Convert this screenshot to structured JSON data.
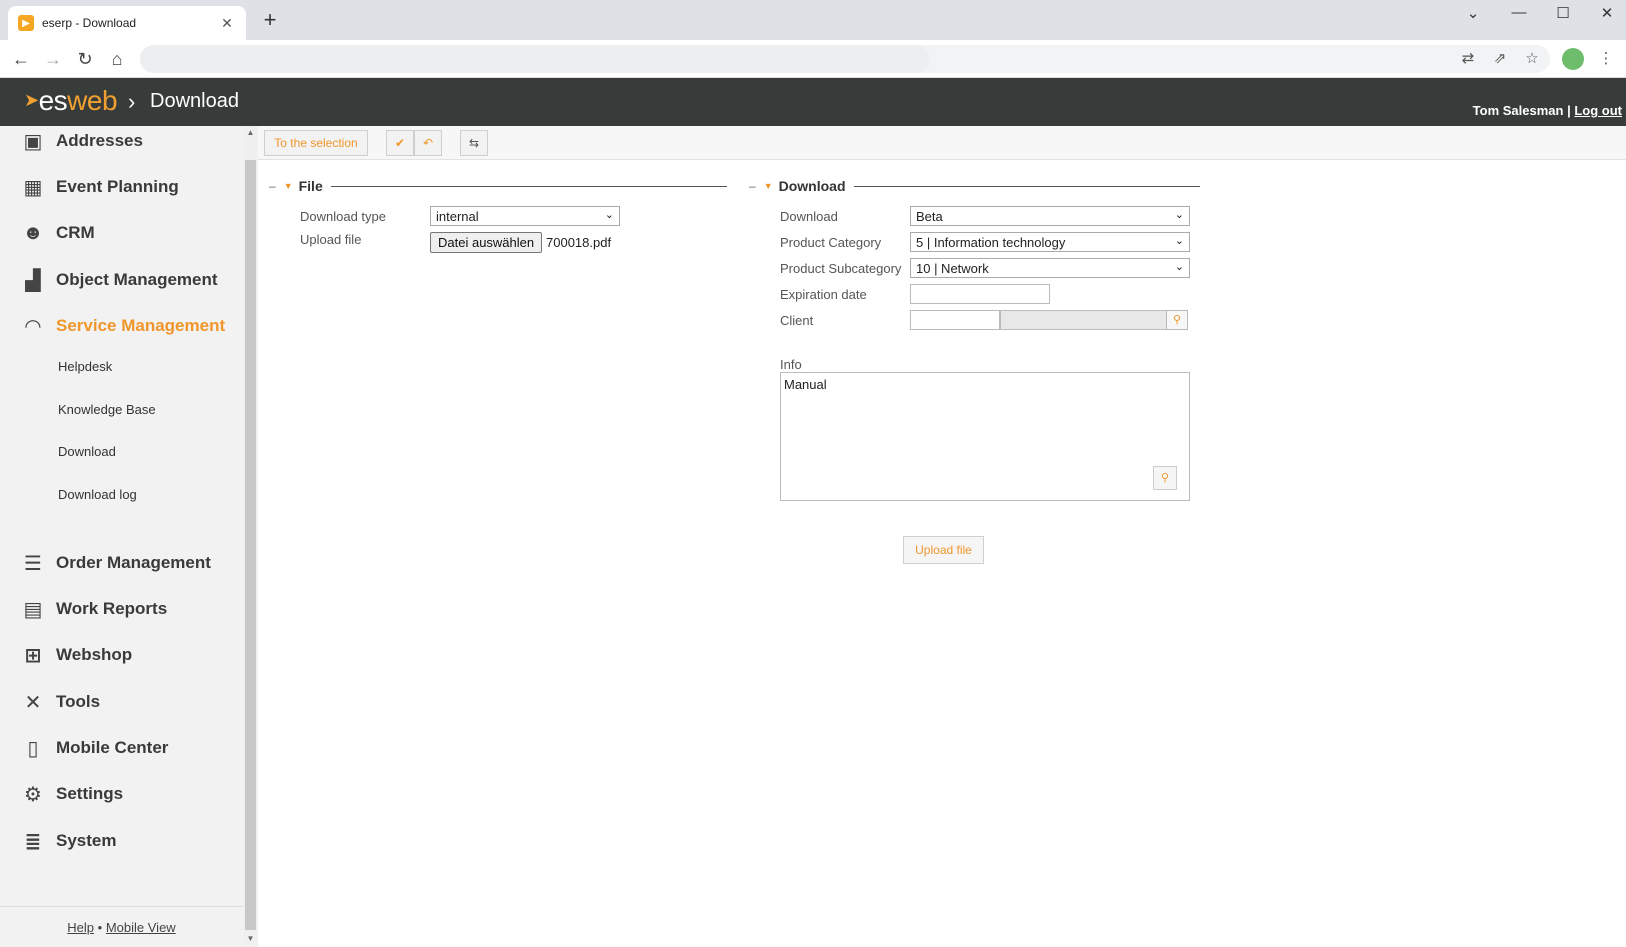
{
  "browser": {
    "tab_title": "eserp - Download",
    "tab_close": "✕",
    "new_tab": "+"
  },
  "header": {
    "logo_es": "es",
    "logo_web": "web",
    "crumb_sep": "›",
    "page_title": "Download",
    "user": "Tom Salesman",
    "separator": "|",
    "logout": "Log out"
  },
  "sidebar": {
    "items": [
      {
        "label": "Addresses",
        "icon": "address-book-icon"
      },
      {
        "label": "Event Planning",
        "icon": "calendar-icon"
      },
      {
        "label": "CRM",
        "icon": "users-icon"
      },
      {
        "label": "Object Management",
        "icon": "factory-icon"
      },
      {
        "label": "Service Management",
        "icon": "headset-icon"
      },
      {
        "label": "Order Management",
        "icon": "list-icon"
      },
      {
        "label": "Work Reports",
        "icon": "clipboard-icon"
      },
      {
        "label": "Webshop",
        "icon": "cart-icon"
      },
      {
        "label": "Tools",
        "icon": "tools-icon"
      },
      {
        "label": "Mobile Center",
        "icon": "mobile-icon"
      },
      {
        "label": "Settings",
        "icon": "gears-icon"
      },
      {
        "label": "System",
        "icon": "database-icon"
      }
    ],
    "sub_items": [
      "Helpdesk",
      "Knowledge Base",
      "Download",
      "Download log"
    ],
    "footer": {
      "help": "Help",
      "dot": "•",
      "mobile_view": "Mobile View"
    }
  },
  "toolbar": {
    "to_selection": "To the selection"
  },
  "file_section": {
    "title": "File",
    "download_type_label": "Download type",
    "download_type_value": "internal",
    "upload_file_label": "Upload file",
    "choose_file_button": "Datei auswählen",
    "file_name": "700018.pdf"
  },
  "download_section": {
    "title": "Download",
    "download_label": "Download",
    "download_value": "Beta",
    "product_category_label": "Product Category",
    "product_category_value": "5 | Information technology",
    "product_subcategory_label": "Product Subcategory",
    "product_subcategory_value": "10 | Network",
    "expiration_date_label": "Expiration date",
    "client_label": "Client",
    "info_label": "Info",
    "info_value": "Manual",
    "upload_button": "Upload file"
  },
  "colors": {
    "accent": "#f0962b",
    "header_bg": "#373b39",
    "sidebar_bg": "#f2f2f2"
  }
}
